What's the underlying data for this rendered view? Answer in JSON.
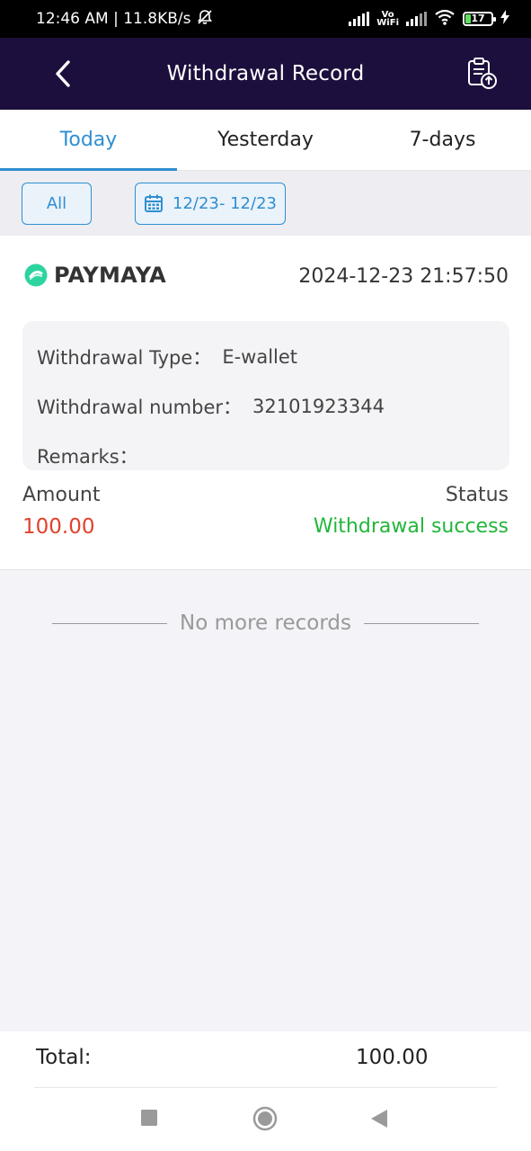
{
  "statusbar": {
    "time_speed": "12:46 AM | 11.8KB/s",
    "volte_line1": "Vo",
    "volte_line2": "WiFi",
    "battery": "17"
  },
  "header": {
    "title": "Withdrawal Record"
  },
  "tabs": [
    {
      "label": "Today",
      "active": true
    },
    {
      "label": "Yesterday",
      "active": false
    },
    {
      "label": "7-days",
      "active": false
    }
  ],
  "filters": {
    "all_label": "All",
    "date_range": "12/23- 12/23"
  },
  "record": {
    "method": "PAYMAYA",
    "datetime": "2024-12-23 21:57:50",
    "type_label": "Withdrawal Type：",
    "type_value": "E-wallet",
    "number_label": "Withdrawal number：",
    "number_value": "32101923344",
    "remarks_label": "Remarks：",
    "remarks_value": "",
    "amount_label": "Amount",
    "amount_value": "100.00",
    "status_label": "Status",
    "status_value": "Withdrawal success"
  },
  "list_end_text": "No more records",
  "footer": {
    "total_label": "Total:",
    "total_value": "100.00"
  },
  "colors": {
    "header_bg": "#1d0f3d",
    "accent": "#2f8fd1",
    "amount": "#e0422c",
    "success": "#22b53a",
    "paymaya_icon": "#2dd4a0"
  }
}
